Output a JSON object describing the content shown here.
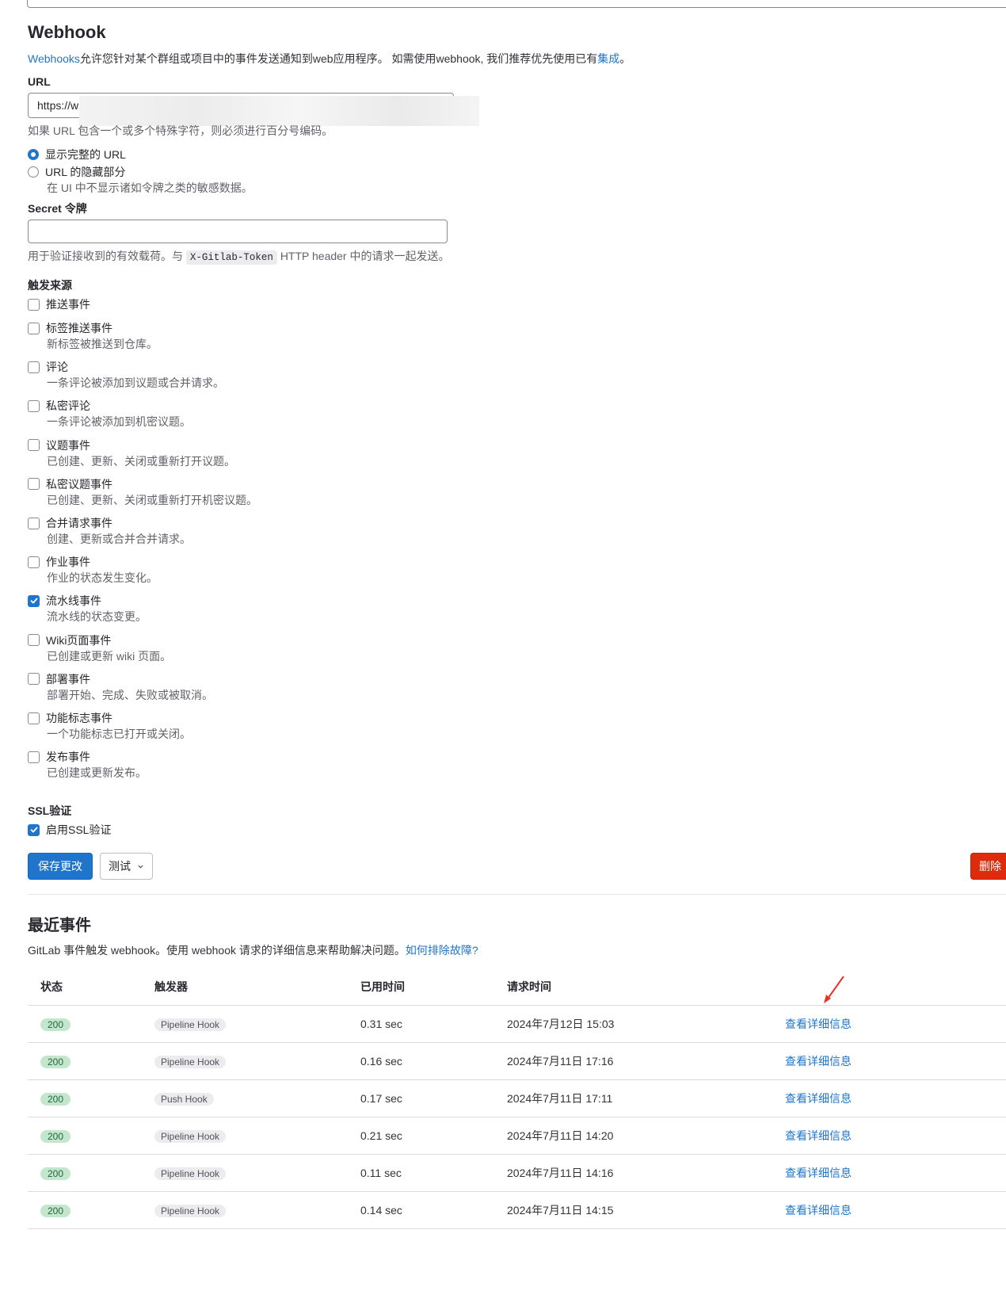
{
  "webhook": {
    "title": "Webhook",
    "desc_link_webhooks": "Webhooks",
    "desc_text": "允许您针对某个群组或项目中的事件发送通知到web应用程序。 如需使用webhook, 我们推荐优先使用已有",
    "desc_link_integrations": "集成",
    "desc_end": "。"
  },
  "url": {
    "label": "URL",
    "value": "https://w",
    "help": "如果 URL 包含一个或多个特殊字符，则必须进行百分号编码。",
    "radio_full": "显示完整的 URL",
    "radio_mask": "URL 的隐藏部分",
    "radio_mask_help": "在 UI 中不显示诸如令牌之类的敏感数据。"
  },
  "secret": {
    "label": "Secret 令牌",
    "value": "",
    "help_before": "用于验证接收到的有效载荷。与",
    "help_code": "X-Gitlab-Token",
    "help_after": "HTTP header 中的请求一起发送。"
  },
  "triggers": {
    "label": "触发来源",
    "items": [
      {
        "label": "推送事件",
        "desc": "",
        "checked": false
      },
      {
        "label": "标签推送事件",
        "desc": "新标签被推送到仓库。",
        "checked": false
      },
      {
        "label": "评论",
        "desc": "一条评论被添加到议题或合并请求。",
        "checked": false
      },
      {
        "label": "私密评论",
        "desc": "一条评论被添加到机密议题。",
        "checked": false
      },
      {
        "label": "议题事件",
        "desc": "已创建、更新、关闭或重新打开议题。",
        "checked": false
      },
      {
        "label": "私密议题事件",
        "desc": "已创建、更新、关闭或重新打开机密议题。",
        "checked": false
      },
      {
        "label": "合并请求事件",
        "desc": "创建、更新或合并合并请求。",
        "checked": false
      },
      {
        "label": "作业事件",
        "desc": "作业的状态发生变化。",
        "checked": false
      },
      {
        "label": "流水线事件",
        "desc": "流水线的状态变更。",
        "checked": true
      },
      {
        "label": "Wiki页面事件",
        "desc": "已创建或更新 wiki 页面。",
        "checked": false
      },
      {
        "label": "部署事件",
        "desc": "部署开始、完成、失败或被取消。",
        "checked": false
      },
      {
        "label": "功能标志事件",
        "desc": "一个功能标志已打开或关闭。",
        "checked": false
      },
      {
        "label": "发布事件",
        "desc": "已创建或更新发布。",
        "checked": false
      }
    ]
  },
  "ssl": {
    "label": "SSL验证",
    "checkbox": "启用SSL验证",
    "checked": true
  },
  "buttons": {
    "save": "保存更改",
    "test": "测试",
    "delete": "删除"
  },
  "recent": {
    "title": "最近事件",
    "desc": "GitLab 事件触发 webhook。使用 webhook 请求的详细信息来帮助解决问题。",
    "desc_link": "如何排除故障?",
    "columns": [
      "状态",
      "触发器",
      "已用时间",
      "请求时间",
      ""
    ],
    "rows": [
      {
        "status": "200",
        "trigger": "Pipeline Hook",
        "elapsed": "0.31 sec",
        "time": "2024年7月12日 15:03",
        "action": "查看详细信息"
      },
      {
        "status": "200",
        "trigger": "Pipeline Hook",
        "elapsed": "0.16 sec",
        "time": "2024年7月11日 17:16",
        "action": "查看详细信息"
      },
      {
        "status": "200",
        "trigger": "Push Hook",
        "elapsed": "0.17 sec",
        "time": "2024年7月11日 17:11",
        "action": "查看详细信息"
      },
      {
        "status": "200",
        "trigger": "Pipeline Hook",
        "elapsed": "0.21 sec",
        "time": "2024年7月11日 14:20",
        "action": "查看详细信息"
      },
      {
        "status": "200",
        "trigger": "Pipeline Hook",
        "elapsed": "0.11 sec",
        "time": "2024年7月11日 14:16",
        "action": "查看详细信息"
      },
      {
        "status": "200",
        "trigger": "Pipeline Hook",
        "elapsed": "0.14 sec",
        "time": "2024年7月11日 14:15",
        "action": "查看详细信息"
      }
    ]
  },
  "colors": {
    "accent": "#1f75cb",
    "danger": "#dd2b0e",
    "success_badge": "#c3e6cd",
    "annotation_arrow": "#e8322b"
  }
}
